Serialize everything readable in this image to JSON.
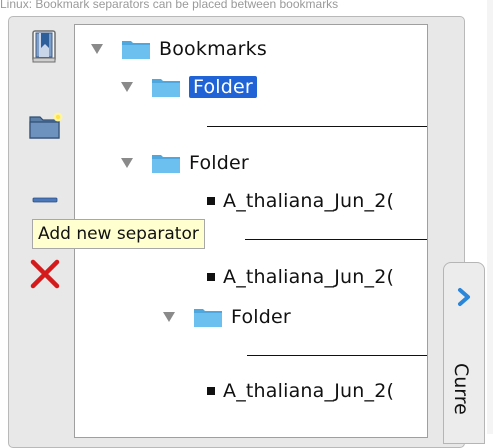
{
  "caption": "Linux: Bookmark separators can be placed between bookmarks",
  "toolbar": {
    "buttons": [
      {
        "name": "add-bookmark",
        "icon": "book-icon"
      },
      {
        "name": "add-folder",
        "icon": "new-folder-icon"
      },
      {
        "name": "add-separator",
        "icon": "separator-icon"
      },
      {
        "name": "delete",
        "icon": "delete-x-icon",
        "color": "#d41a1a"
      }
    ],
    "tooltip": "Add new separator"
  },
  "tree": {
    "root": "Bookmarks",
    "items": [
      {
        "type": "folder",
        "label": "Folder",
        "selected": true
      },
      {
        "type": "separator"
      },
      {
        "type": "folder",
        "label": "Folder"
      },
      {
        "type": "bookmark",
        "label": "A_thaliana_Jun_2("
      },
      {
        "type": "separator"
      },
      {
        "type": "bookmark",
        "label": "A_thaliana_Jun_2("
      },
      {
        "type": "folder",
        "label": "Folder"
      },
      {
        "type": "separator"
      },
      {
        "type": "bookmark",
        "label": "A_thaliana_Jun_2("
      }
    ]
  },
  "side_tab": {
    "label": "Curre",
    "accent": "#2a86d8"
  },
  "colors": {
    "selection": "#1f63d6",
    "folder": "#5bb3e8",
    "tooltip_bg": "#ffffcf"
  }
}
